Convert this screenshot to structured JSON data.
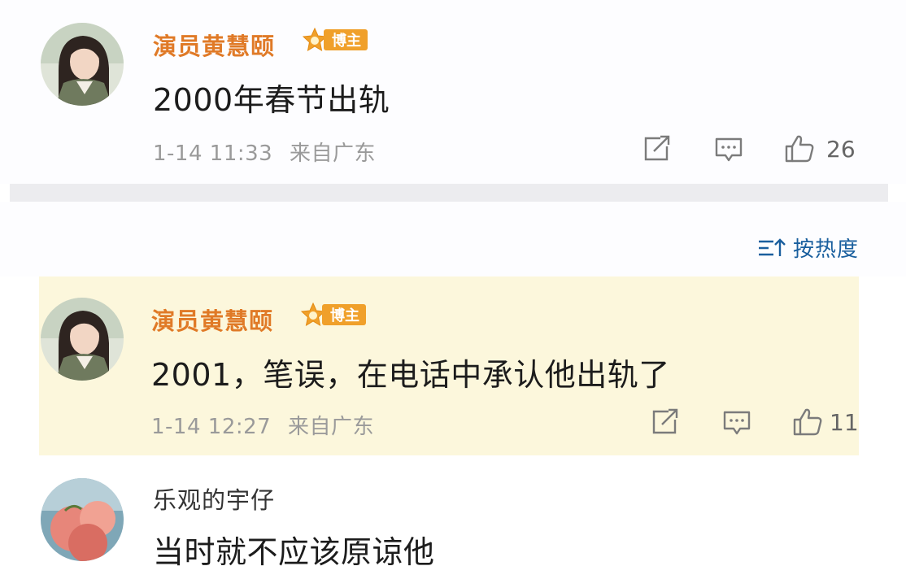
{
  "post": {
    "author": "演员黄慧颐",
    "badge": "博主",
    "text": "2000年春节出轨",
    "time": "1-14 11:33",
    "source": "来自广东",
    "like_count": "26"
  },
  "sort": {
    "label": "按热度"
  },
  "reply_pinned": {
    "author": "演员黄慧颐",
    "badge": "博主",
    "text": "2001，笔误，在电话中承认他出轨了",
    "time": "1-14 12:27",
    "source": "来自广东",
    "like_count": "11"
  },
  "reply_second": {
    "author": "乐观的宇仔",
    "text": "当时就不应该原谅他"
  },
  "icons": {
    "share": "share-icon",
    "comment": "comment-icon",
    "like": "thumbs-up-icon",
    "sort": "sort-icon",
    "badge": "badge-star-icon"
  },
  "colors": {
    "author_vip": "#e07a27",
    "badge_bg": "#f0a02a",
    "highlight_bg": "#fcf7dc",
    "link_blue": "#1a5f9e",
    "meta_gray": "#9a9a9a"
  }
}
